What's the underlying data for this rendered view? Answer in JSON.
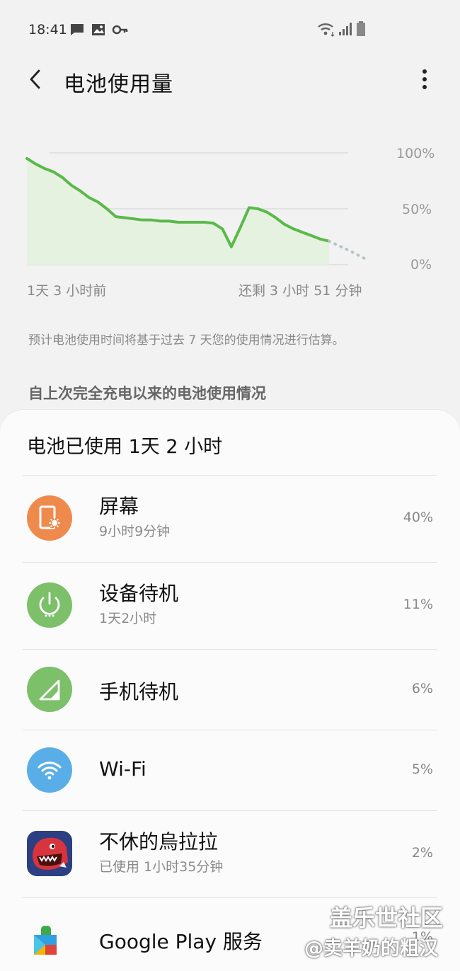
{
  "status_bar": {
    "time": "18:41",
    "icons": [
      "message-icon",
      "gallery-icon",
      "key-icon",
      "wifi-icon",
      "signal-icon",
      "battery-icon"
    ]
  },
  "app_bar": {
    "title": "电池使用量",
    "back_icon": "back-arrow-icon",
    "more_icon": "more-vert-icon"
  },
  "chart_data": {
    "type": "line",
    "y_ticks": [
      "100%",
      "50%",
      "0%"
    ],
    "ylim": [
      0,
      100
    ],
    "x_labels": [
      "1天 3 小时前",
      "还剩 3 小时 51 分钟"
    ],
    "series": [
      {
        "values": [
          95,
          90,
          86,
          83,
          78,
          71,
          66,
          60,
          56,
          50,
          43,
          42,
          41,
          40,
          40,
          39,
          39,
          38,
          38,
          38,
          38,
          37,
          32,
          16,
          33,
          51,
          50,
          47,
          42,
          36,
          32,
          29,
          26,
          23,
          21
        ]
      }
    ],
    "projection": [
      21,
      13,
      4
    ],
    "colors": {
      "line": "#5ab94a",
      "fill": "#e6f2e0",
      "projection": "#b5c4c8",
      "grid": "#dedede"
    }
  },
  "estimate_note": "预计电池使用时间将基于过去 7 天您的使用情况进行估算。",
  "section_header": "自上次完全充电以来的电池使用情况",
  "card": {
    "title": "电池已使用 1天 2 小时",
    "items": [
      {
        "name": "屏幕",
        "sub": "9小时9分钟",
        "percent": "40%",
        "icon": "screen-brightness-icon",
        "icon_color": "#ef8a4d"
      },
      {
        "name": "设备待机",
        "sub": "1天2小时",
        "percent": "11%",
        "icon": "power-icon",
        "icon_color": "#7cc06a"
      },
      {
        "name": "手机待机",
        "sub": "",
        "percent": "6%",
        "icon": "cell-signal-icon",
        "icon_color": "#7cc06a"
      },
      {
        "name": "Wi-Fi",
        "sub": "",
        "percent": "5%",
        "icon": "wifi-icon",
        "icon_color": "#5aaee8"
      },
      {
        "name": "不休的烏拉拉",
        "sub": "已使用 1小时35分钟",
        "percent": "2%",
        "icon": "game-app-icon",
        "icon_color": "#c8333b"
      },
      {
        "name": "Google Play 服务",
        "sub": "",
        "percent": "1%",
        "icon": "google-play-services-icon",
        "icon_color": "#3ea84a"
      }
    ]
  },
  "watermark": {
    "line1": "盖乐世社区",
    "line2": "@卖羊奶的粗汉"
  }
}
